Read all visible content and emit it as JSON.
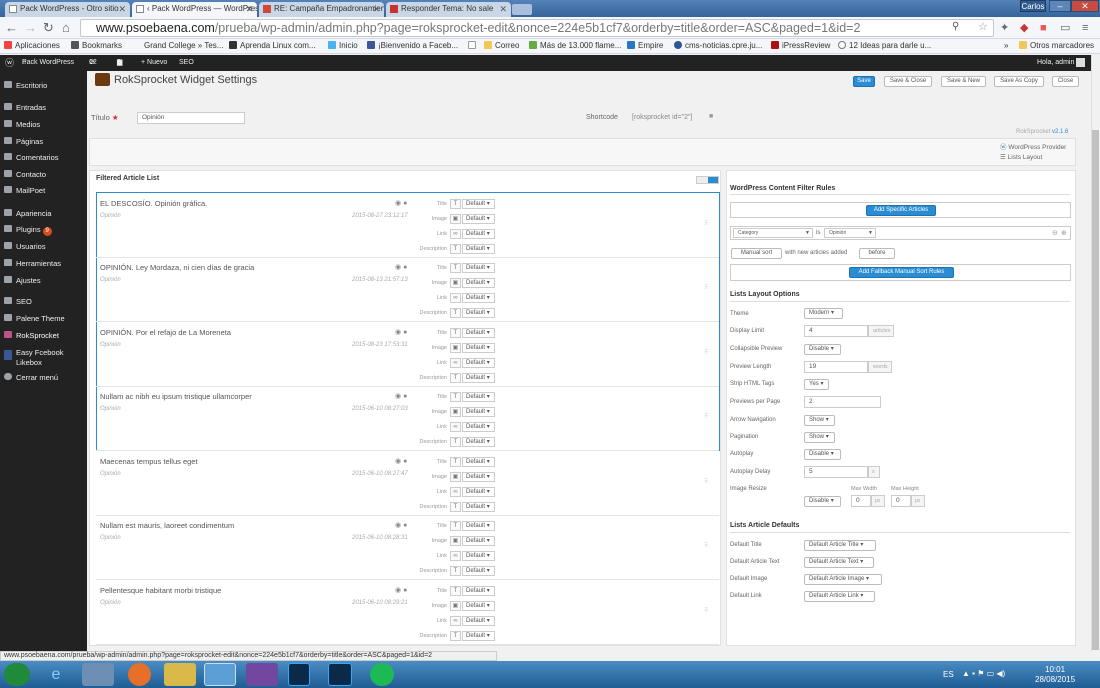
{
  "browser": {
    "tabs": [
      {
        "label": "Pack WordPress - Otro sitio"
      },
      {
        "label": "‹ Pack WordPress — WordPress"
      },
      {
        "label": "RE: Campaña Empadronamiento"
      },
      {
        "label": "Responder Tema: No sale"
      }
    ],
    "user": "Carlos",
    "url_host": "www.psoebaena.com",
    "url_path": "/prueba/wp-admin/admin.php?page=roksprocket-edit&nonce=224e5b1cf7&orderby=title&order=ASC&paged=1&id=2",
    "bookmarks": [
      "Aplicaciones",
      "Bookmarks",
      "Grand College » Tes...",
      "Aprenda Linux com...",
      "Inicio",
      "¡Bienvenido a Faceb...",
      "Correo",
      "Más de 13.000 flame...",
      "Empire",
      "cms-noticias.cpre.ju...",
      "iPressReview",
      "12 Ideas para darle u..."
    ],
    "bookmarks_more": "»",
    "other_bookmarks": "Otros marcadores",
    "status_url": "www.psoebaena.com/prueba/wp-admin/admin.php?page=roksprocket-edit&nonce=224e5b1cf7&orderby=title&order=ASC&paged=1&id=2"
  },
  "adminbar": {
    "site": "Pack WordPress",
    "updates": "12",
    "comments": "0",
    "new": "+ Nuevo",
    "seo": "SEO",
    "greeting": "Hola, admin"
  },
  "menu": [
    "Escritorio",
    "Entradas",
    "Medios",
    "Páginas",
    "Comentarios",
    "Contacto",
    "MailPoet",
    "Apariencia",
    "Plugins",
    "Usuarios",
    "Herramientas",
    "Ajustes",
    "SEO",
    "Palene Theme",
    "RokSprocket",
    "Easy Fcebook Likebox",
    "Cerrar menú"
  ],
  "plugins_badge": "9",
  "page": {
    "title": "RokSprocket Widget Settings",
    "buttons": [
      "Save",
      "Save & Close",
      "Save & New",
      "Save As Copy",
      "Close"
    ],
    "titulo_label": "Título",
    "required_mark": "★",
    "titulo_value": "Opinión",
    "shortcode_label": "Shortcode",
    "shortcode_value": "[roksprocket id=\"2\"]",
    "version_label": "RokSprocket",
    "version": "v2.1.6",
    "provider": "WordPress Provider",
    "layout": "Lists Layout"
  },
  "articles_header": "Filtered Article List",
  "row_labels": [
    "Title",
    "Image",
    "Link",
    "Description"
  ],
  "row_default": "Default",
  "articles": [
    {
      "title": "EL DESCOSÍO. Opinión gráfica.",
      "category": "Opinión",
      "date": "2015-08-27 23:12:17"
    },
    {
      "title": "OPINIÓN. Ley Mordaza, ni cien días de gracia",
      "category": "Opinión",
      "date": "2015-08-13 21:57:13"
    },
    {
      "title": "OPINIÓN. Por el refajo de La Moreneta",
      "category": "Opinión",
      "date": "2015-08-23 17:53:31"
    },
    {
      "title": "Nullam ac nibh eu ipsum tristique ullamcorper",
      "category": "Opinión",
      "date": "2015-06-10 08:27:03"
    },
    {
      "title": "Maecenas tempus tellus eget",
      "category": "Opinión",
      "date": "2015-06-10 08:27:47"
    },
    {
      "title": "Nullam est mauris, laoreet condimentum",
      "category": "Opinión",
      "date": "2015-06-10 08:28:31"
    },
    {
      "title": "Pellentesque habitant morbi tristique",
      "category": "Opinión",
      "date": "2015-06-10 08:29:21"
    }
  ],
  "filters": {
    "heading": "WordPress Content Filter Rules",
    "add_specific": "Add Specific Articles",
    "category_select": "Category",
    "is_label": "is",
    "category_value": "Opinión",
    "sort": "Manual sort",
    "with_new": "with new articles added",
    "before": "before",
    "add_fallback": "Add Fallback Manual Sort Rules"
  },
  "layout_options": {
    "heading": "Lists Layout Options",
    "theme_label": "Theme",
    "theme": "Modern",
    "display_limit_label": "Display Limit",
    "display_limit": "4",
    "display_limit_unit": "articles",
    "collapsible_label": "Collapsible Preview",
    "collapsible": "Disable",
    "preview_length_label": "Preview Length",
    "preview_length": "19",
    "preview_length_unit": "words",
    "strip_label": "Strip HTML Tags",
    "strip": "Yes",
    "previews_per_page_label": "Previews per Page",
    "previews_per_page": "2",
    "arrow_label": "Arrow Navigation",
    "arrow": "Show",
    "pagination_label": "Pagination",
    "pagination": "Show",
    "autoplay_label": "Autoplay",
    "autoplay": "Disable",
    "autoplay_delay_label": "Autoplay Delay",
    "autoplay_delay": "5",
    "autoplay_delay_unit": "s",
    "image_resize_label": "Image Resize",
    "image_resize": "Disable",
    "max_width_label": "Max Width",
    "max_width": "0",
    "max_height_label": "Max Height",
    "max_height": "0",
    "px": "px"
  },
  "defaults": {
    "heading": "Lists Article Defaults",
    "title_label": "Default Title",
    "title": "Default Article Title",
    "text_label": "Default Article Text",
    "text": "Default Article Text",
    "image_label": "Default Image",
    "image": "Default Article Image",
    "link_label": "Default Link",
    "link": "Default Article Link"
  },
  "taskbar": {
    "lang": "ES",
    "time": "10:01",
    "date": "28/08/2015"
  }
}
